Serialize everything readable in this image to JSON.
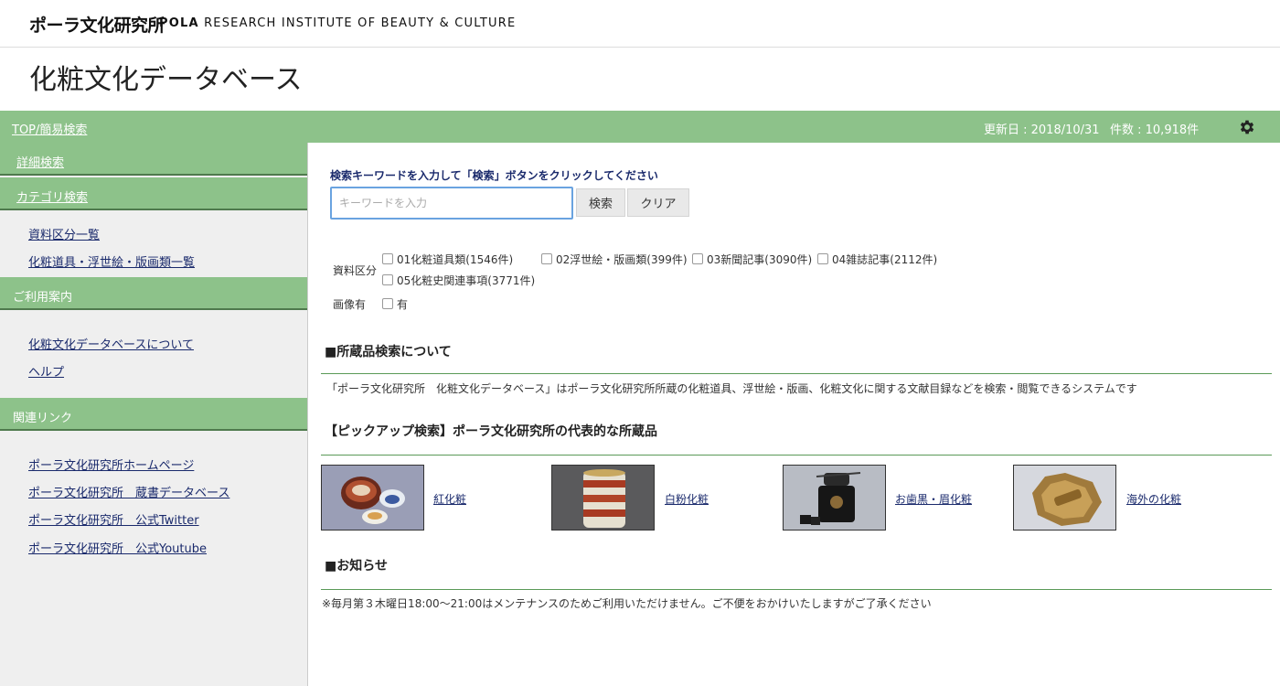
{
  "header": {
    "logo_jp": "ポーラ文化研究所",
    "logo_en_bold": "POLA",
    "logo_en_rest": "RESEARCH INSTITUTE OF BEAUTY & CULTURE"
  },
  "page_title": "化粧文化データベース",
  "greenbar": {
    "top_link": "TOP/簡易検索",
    "updated": "更新日 : 2018/10/31",
    "count": "件数 : 10,918件"
  },
  "sidebar": {
    "detailed_search": "詳細検索",
    "category_search": "カテゴリ検索",
    "category_links": [
      "資料区分一覧",
      "化粧道具・浮世絵・版画類一覧"
    ],
    "guide_head": "ご利用案内",
    "guide_links": [
      "化粧文化データベースについて",
      "ヘルプ"
    ],
    "related_head": "関連リンク",
    "related_links": [
      "ポーラ文化研究所ホームページ",
      "ポーラ文化研究所　蔵書データベース",
      "ポーラ文化研究所　公式Twitter",
      "ポーラ文化研究所　公式Youtube"
    ]
  },
  "search": {
    "instruction": "検索キーワードを入力して「検索」ボタンをクリックしてください",
    "placeholder": "キーワードを入力",
    "value": "",
    "search_button": "検索",
    "clear_button": "クリア"
  },
  "filters": {
    "category_label": "資料区分",
    "categories": [
      {
        "label": "01化粧道具類(1546件)",
        "checked": false
      },
      {
        "label": "02浮世絵・版画類(399件)",
        "checked": false
      },
      {
        "label": "03新聞記事(3090件)",
        "checked": false
      },
      {
        "label": "04雑誌記事(2112件)",
        "checked": false
      },
      {
        "label": "05化粧史関連事項(3771件)",
        "checked": false
      }
    ],
    "image_label": "画像有",
    "image_option": "有"
  },
  "about": {
    "title": "■所蔵品検索について",
    "text": "「ポーラ文化研究所　化粧文化データベース」はポーラ文化研究所所蔵の化粧道具、浮世絵・版画、化粧文化に関する文献目録などを検索・閲覧できるシステムです"
  },
  "pickup": {
    "title": "【ピックアップ検索】ポーラ文化研究所の代表的な所蔵品",
    "items": [
      {
        "label": "紅化粧",
        "image": "red-makeup-bowls-thumbnail"
      },
      {
        "label": "白粉化粧",
        "image": "white-powder-container-thumbnail"
      },
      {
        "label": "お歯黒・眉化粧",
        "image": "teeth-blackening-set-thumbnail"
      },
      {
        "label": "海外の化粧",
        "image": "foreign-cosmetic-box-thumbnail"
      }
    ]
  },
  "notice": {
    "title": "■お知らせ",
    "text": "※毎月第３木曜日18:00〜21:00はメンテナンスのためご利用いただけません。ご不便をおかけいたしますがご了承ください"
  },
  "colors": {
    "green": "#8dc28a",
    "green_dark": "#4f7a4d",
    "link": "#1a2a6c",
    "input_focus": "#6aa3e0"
  }
}
